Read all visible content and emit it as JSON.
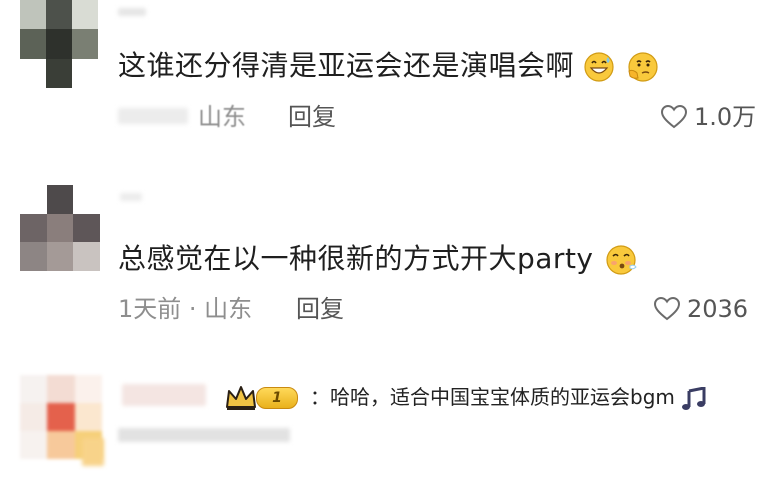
{
  "comments": [
    {
      "text": "这谁还分得清是亚运会还是演唱会啊",
      "location": "山东",
      "reply_label": "回复",
      "likes": "1.0万"
    },
    {
      "text": "总感觉在以一种很新的方式开大party",
      "time": "1天前 · 山东",
      "reply_label": "回复",
      "likes": "2036"
    },
    {
      "colon": "：",
      "text": "哈哈，适合中国宝宝体质的亚运会bgm",
      "badge_level": "1"
    }
  ],
  "icons": {
    "like": "heart-outline-icon",
    "crown": "crown-icon",
    "music": "music-note-icon",
    "emoji_sweat_grin": "grinning-sweat-emoji",
    "emoji_thinking": "thinking-emoji",
    "emoji_blowing": "blowing-emoji"
  },
  "colors": {
    "text": "#1f1f1f",
    "meta": "#8e8e8e",
    "badge_gold": "#e9b11c"
  }
}
